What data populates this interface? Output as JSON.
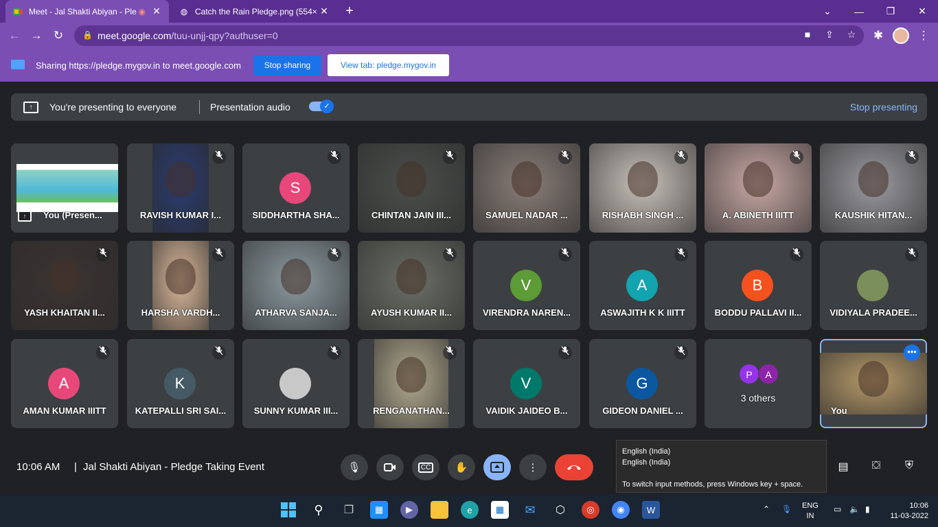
{
  "browser": {
    "tabs": [
      {
        "title": "Meet - Jal Shakti Abiyan - Ple",
        "recording": "◉"
      },
      {
        "title": "Catch the Rain Pledge.png (554×"
      }
    ],
    "url_host": "meet.google.com",
    "url_path": "/tuu-unjj-qpy?authuser=0"
  },
  "share_bar": {
    "text": "Sharing https://pledge.mygov.in to meet.google.com",
    "stop_label": "Stop sharing",
    "view_label": "View tab: pledge.mygov.in"
  },
  "presenting": {
    "text": "You're presenting to everyone",
    "audio_label": "Presentation audio",
    "stop_label": "Stop presenting",
    "audio_on": true
  },
  "participants": [
    {
      "name": "You (Presen...",
      "type": "screen"
    },
    {
      "name": "RAVISH KUMAR I...",
      "type": "video",
      "tone": "#2a3b70"
    },
    {
      "name": "SIDDHARTHA SHA...",
      "type": "avatar",
      "initial": "S",
      "color": "#e8477a"
    },
    {
      "name": "CHINTAN JAIN III...",
      "type": "video",
      "tone": "#4b4f4c"
    },
    {
      "name": "SAMUEL NADAR ...",
      "type": "video",
      "tone": "#8a7e78"
    },
    {
      "name": "RISHABH SINGH ...",
      "type": "video",
      "tone": "#c9c2bb"
    },
    {
      "name": "A. ABINETH IIITT",
      "type": "video",
      "tone": "#c9a9a6"
    },
    {
      "name": "KAUSHIK HITAN...",
      "type": "video",
      "tone": "#9a9aa0"
    },
    {
      "name": "YASH KHAITAN II...",
      "type": "video",
      "tone": "#3b3432"
    },
    {
      "name": "HARSHA VARDH...",
      "type": "video",
      "tone": "#d9b79a"
    },
    {
      "name": "ATHARVA SANJA...",
      "type": "video",
      "tone": "#8c9aa0"
    },
    {
      "name": "AYUSH KUMAR II...",
      "type": "video",
      "tone": "#6b6f66"
    },
    {
      "name": "VIRENDRA NAREN...",
      "type": "avatar",
      "initial": "V",
      "color": "#5c9b35"
    },
    {
      "name": "ASWAJITH K K IIITT",
      "type": "avatar",
      "initial": "A",
      "color": "#12a4af"
    },
    {
      "name": "BODDU PALLAVI II...",
      "type": "avatar",
      "initial": "B",
      "color": "#f4511e"
    },
    {
      "name": "VIDIYALA PRADEE...",
      "type": "photo",
      "color": "#7a8f5a"
    },
    {
      "name": "AMAN KUMAR IIITT",
      "type": "avatar",
      "initial": "A",
      "color": "#e8477a"
    },
    {
      "name": "KATEPALLI SRI SAI...",
      "type": "avatar",
      "initial": "K",
      "color": "#455a64"
    },
    {
      "name": "SUNNY KUMAR III...",
      "type": "photo",
      "color": "#c8c8c8"
    },
    {
      "name": "RENGANATHAN...",
      "type": "video",
      "tone": "#b1a98e"
    },
    {
      "name": "VAIDIK JAIDEO B...",
      "type": "avatar",
      "initial": "V",
      "color": "#00796b"
    },
    {
      "name": "GIDEON DANIEL ...",
      "type": "avatar",
      "initial": "G",
      "color": "#0b57a0"
    },
    {
      "name": "3 others",
      "type": "others",
      "initials": [
        "P",
        "A"
      ],
      "colors": [
        "#9334e6",
        "#8e24aa"
      ]
    },
    {
      "name": "You",
      "type": "self",
      "tone": "#b79b6a"
    }
  ],
  "controls": {
    "time": "10:06 AM",
    "separator": "|",
    "meeting_title": "Jal Shakti Abiyan - Pledge Taking Event"
  },
  "tooltip": {
    "line1": "English (India)",
    "line2": "English (India)",
    "line3": "To switch input methods, press Windows key + space."
  },
  "taskbar": {
    "lang_top": "ENG",
    "lang_bottom": "IN",
    "time": "10:06",
    "date": "11-03-2022"
  }
}
